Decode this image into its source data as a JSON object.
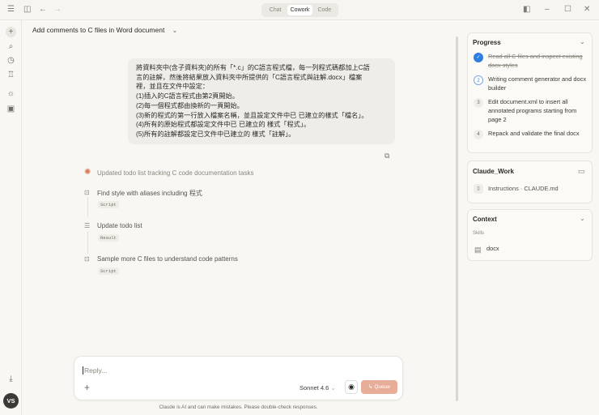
{
  "titlebar": {
    "modes": [
      "Chat",
      "Cowork",
      "Code"
    ],
    "active_mode": "Cowork"
  },
  "conversation": {
    "title": "Add comments to C files in Word document"
  },
  "user_message": {
    "lines": [
      "將資料夾中(含子資料夾)的所有「*.c」的C語言程式檔，每一列程式碼都加上C語",
      "言的註解，然後將結果放入資料夾中所提供的「C語言程式與註解.docx」檔案",
      "裡，並且在文件中設定：",
      "(1)插入的C語言程式由第2頁開始。",
      "(2)每一個程式都由換新的一頁開始。",
      "(3)新的程式的第一行放入檔案名稱，並且設定文件中已 已建立的樣式「檔名」。",
      "(4)所有的原始程式都設定文件中已 已建立的 樣式「程式」。",
      "(5)所有的註解都設定已文件中已建立的 樣式「註解」。"
    ]
  },
  "activity": {
    "header": "Updated todo list tracking C code documentation tasks",
    "steps": [
      {
        "label": "Find style with aliases including 程式",
        "tag": "Script"
      },
      {
        "label": "Update todo list",
        "tag": "Result"
      },
      {
        "label": "Sample more C files to understand code patterns",
        "tag": "Script"
      }
    ]
  },
  "composer": {
    "placeholder": "Reply...",
    "model": "Sonnet 4.6",
    "queue_label": "Queue",
    "disclaimer": "Claude is AI and can make mistakes. Please double-check responses."
  },
  "progress": {
    "title": "Progress",
    "items": [
      {
        "num": "1",
        "text": "Read all C files and inspect existing docx styles",
        "status": "done"
      },
      {
        "num": "2",
        "text": "Writing comment generator and docx builder",
        "status": "active"
      },
      {
        "num": "3",
        "text": "Edit document.xml to insert all annotated programs starting from page 2",
        "status": "pending"
      },
      {
        "num": "4",
        "text": "Repack and validate the final docx",
        "status": "pending"
      }
    ]
  },
  "workspace": {
    "title": "Claude_Work",
    "file": "Instructions · CLAUDE.md"
  },
  "context": {
    "title": "Context",
    "skills_label": "Skills",
    "skill": "docx"
  },
  "user": {
    "initials": "VS"
  },
  "colors": {
    "accent": "#d97757",
    "check": "#2f7de1"
  }
}
